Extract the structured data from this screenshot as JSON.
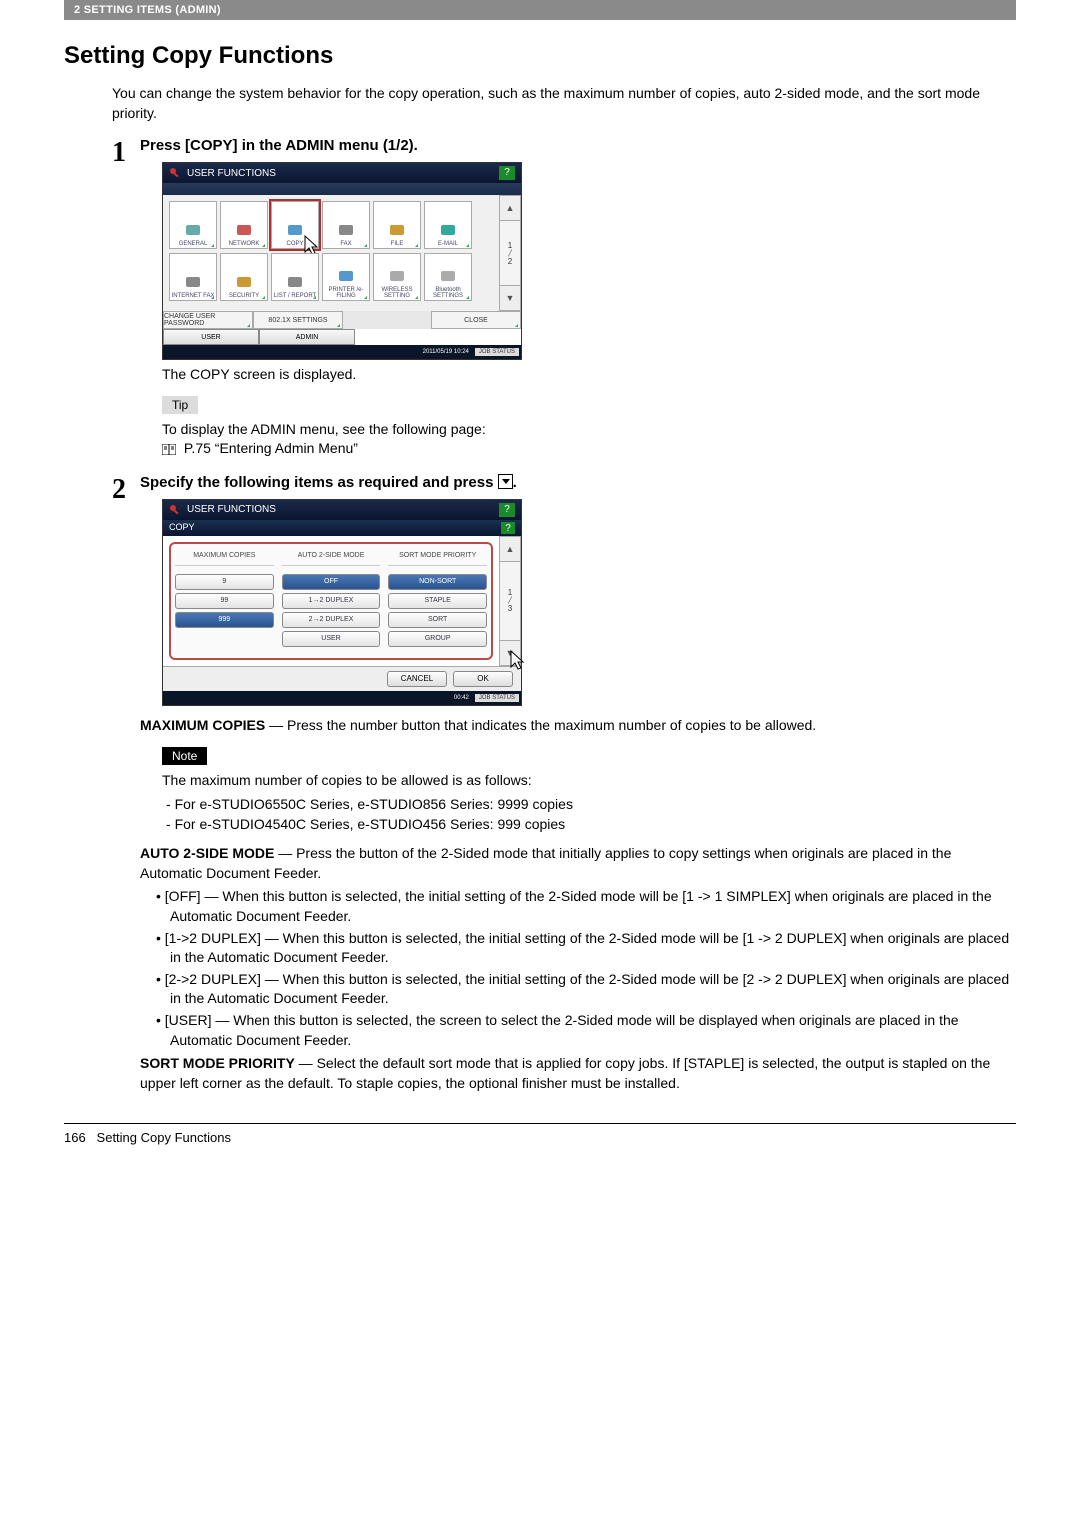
{
  "topbar": "2 SETTING ITEMS (ADMIN)",
  "heading": "Setting Copy Functions",
  "intro": "You can change the system behavior for the copy operation, such as the maximum number of copies, auto 2-sided mode, and the sort mode priority.",
  "step1": {
    "num": "1",
    "title": "Press [COPY] in the ADMIN menu (1/2).",
    "screenshot": {
      "title": "USER FUNCTIONS",
      "help": "?",
      "icons_row1": [
        "GENERAL",
        "NETWORK",
        "COPY",
        "FAX",
        "FILE",
        "E-MAIL"
      ],
      "icons_row2": [
        "INTERNET FAX",
        "SECURITY",
        "LIST / REPORT",
        "PRINTER /e-FILING",
        "WIRELESS SETTING",
        "Bluetooth SETTINGS"
      ],
      "page_ind": "1 / 2",
      "bot_buttons": [
        "CHANGE USER PASSWORD",
        "802.1X SETTINGS",
        "",
        "CLOSE"
      ],
      "tabs": [
        "USER",
        "ADMIN"
      ],
      "timestamp": "2011/05/19 10:24",
      "job": "JOB STATUS"
    },
    "caption": "The COPY screen is displayed.",
    "tip_label": "Tip",
    "tip_text": "To display the ADMIN menu, see the following page:",
    "ref": "P.75 “Entering Admin Menu”"
  },
  "step2": {
    "num": "2",
    "title_a": "Specify the following items as required and press ",
    "title_b": ".",
    "screenshot": {
      "title": "USER FUNCTIONS",
      "sub": "COPY",
      "help": "?",
      "col1": {
        "head": "MAXIMUM COPIES",
        "opts": [
          "9",
          "99",
          "999"
        ],
        "sel": 2
      },
      "col2": {
        "head": "AUTO 2-SIDE MODE",
        "opts": [
          "OFF",
          "1→2 DUPLEX",
          "2→2 DUPLEX",
          "USER"
        ],
        "sel": 0
      },
      "col3": {
        "head": "SORT MODE PRIORITY",
        "opts": [
          "NON-SORT",
          "STAPLE",
          "SORT",
          "GROUP"
        ],
        "sel": 0
      },
      "page_ind": "1 / 3",
      "cancel": "CANCEL",
      "ok": "OK",
      "timestamp": "00:42",
      "job": "JOB STATUS"
    },
    "maxcopies": {
      "label": "MAXIMUM COPIES",
      "desc": " — Press the number button that indicates the maximum number of copies to be allowed."
    },
    "note_label": "Note",
    "note_intro": "The maximum number of copies to be allowed is as follows:",
    "note_items": [
      "For e-STUDIO6550C Series, e-STUDIO856 Series: 9999 copies",
      "For e-STUDIO4540C Series, e-STUDIO456 Series: 999 copies"
    ],
    "auto2": {
      "label": "AUTO 2-SIDE MODE",
      "desc": " — Press the button of the 2-Sided mode that initially applies to copy settings when originals are placed in the Automatic Document Feeder.",
      "items": [
        "[OFF] — When this button is selected, the initial setting of the 2-Sided mode will be [1 -> 1 SIMPLEX] when originals are placed in the Automatic Document Feeder.",
        "[1->2 DUPLEX] — When this button is selected, the initial setting of the 2-Sided mode will be [1 -> 2 DUPLEX] when originals are placed in the Automatic Document Feeder.",
        "[2->2 DUPLEX] — When this button is selected, the initial setting of the 2-Sided mode will be [2 -> 2 DUPLEX] when originals are placed in the Automatic Document Feeder.",
        "[USER] — When this button is selected, the screen to select the 2-Sided mode will be displayed when originals are placed in the Automatic Document Feeder."
      ]
    },
    "sortmode": {
      "label": "SORT MODE PRIORITY",
      "desc": " — Select the default sort mode that is applied for copy jobs. If [STAPLE] is selected, the output is stapled on the upper left corner as the default. To staple copies, the optional finisher must be installed."
    }
  },
  "footer": {
    "page": "166",
    "title": "Setting Copy Functions"
  }
}
